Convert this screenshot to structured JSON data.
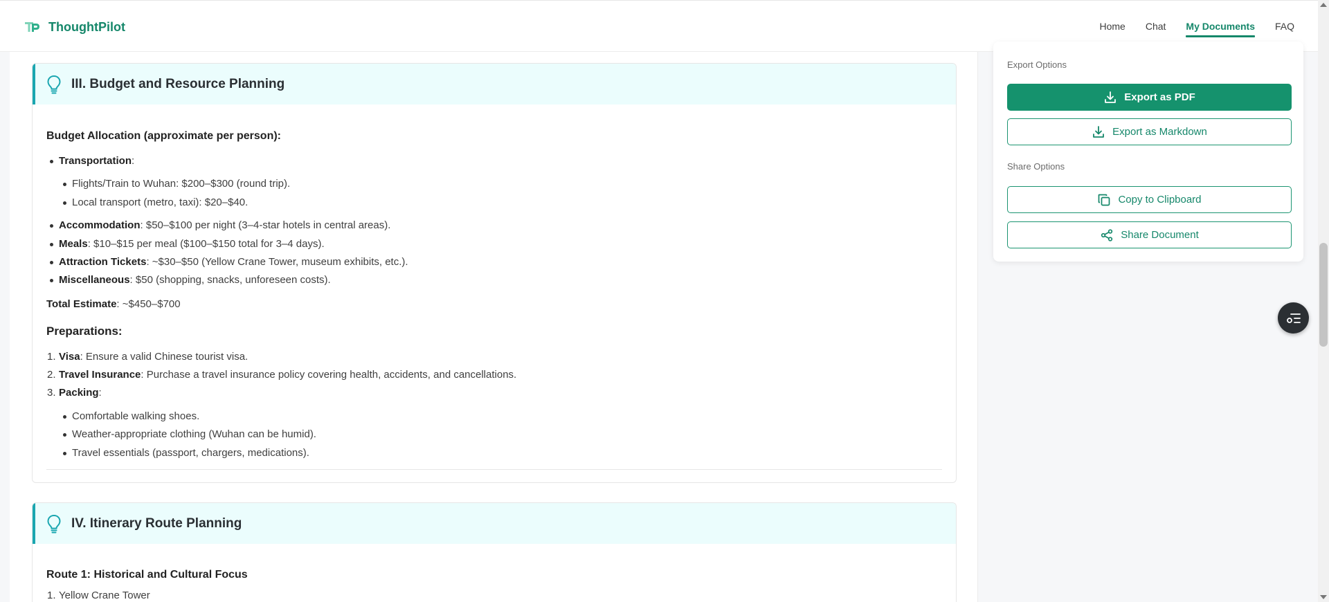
{
  "brand": {
    "name": "ThoughtPilot",
    "accent": "#15876a"
  },
  "nav": [
    {
      "label": "Home"
    },
    {
      "label": "Chat"
    },
    {
      "label": "My Documents",
      "active": true
    },
    {
      "label": "FAQ"
    }
  ],
  "section3": {
    "title": "III. Budget and Resource Planning",
    "icon": "lightbulb-icon",
    "budget_heading": "Budget Allocation (approximate per person):",
    "transport_label": "Transportation",
    "transport_sub": [
      "Flights/Train to Wuhan: $200–$300 (round trip).",
      "Local transport (metro, taxi): $20–$40."
    ],
    "items": [
      {
        "label": "Accommodation",
        "text": ": $50–$100 per night (3–4-star hotels in central areas)."
      },
      {
        "label": "Meals",
        "text": ": $10–$15 per meal ($100–$150 total for 3–4 days)."
      },
      {
        "label": "Attraction Tickets",
        "text": ": ~$30–$50 (Yellow Crane Tower, museum exhibits, etc.)."
      },
      {
        "label": "Miscellaneous",
        "text": ": $50 (shopping, snacks, unforeseen costs)."
      }
    ],
    "total_label": "Total Estimate",
    "total_text": ": ~$450–$700",
    "prep_heading": "Preparations:",
    "prep_items": [
      {
        "label": "Visa",
        "text": ": Ensure a valid Chinese tourist visa."
      },
      {
        "label": "Travel Insurance",
        "text": ": Purchase a travel insurance policy covering health, accidents, and cancellations."
      },
      {
        "label": "Packing",
        "text": ":"
      }
    ],
    "packing_sub": [
      "Comfortable walking shoes.",
      "Weather-appropriate clothing (Wuhan can be humid).",
      "Travel essentials (passport, chargers, medications)."
    ]
  },
  "section4": {
    "title": "IV. Itinerary Route Planning",
    "icon": "lightbulb-icon",
    "route_heading": "Route 1: Historical and Cultural Focus",
    "first_item": "Yellow Crane Tower"
  },
  "sidebar": {
    "export_label": "Export Options",
    "export_pdf": "Export as PDF",
    "export_md": "Export as Markdown",
    "share_label": "Share Options",
    "copy": "Copy to Clipboard",
    "share": "Share Document"
  },
  "colors": {
    "primary": "#15926d",
    "section_head_bg": "#ebfdfd",
    "section_accent": "#1aa6b0"
  }
}
